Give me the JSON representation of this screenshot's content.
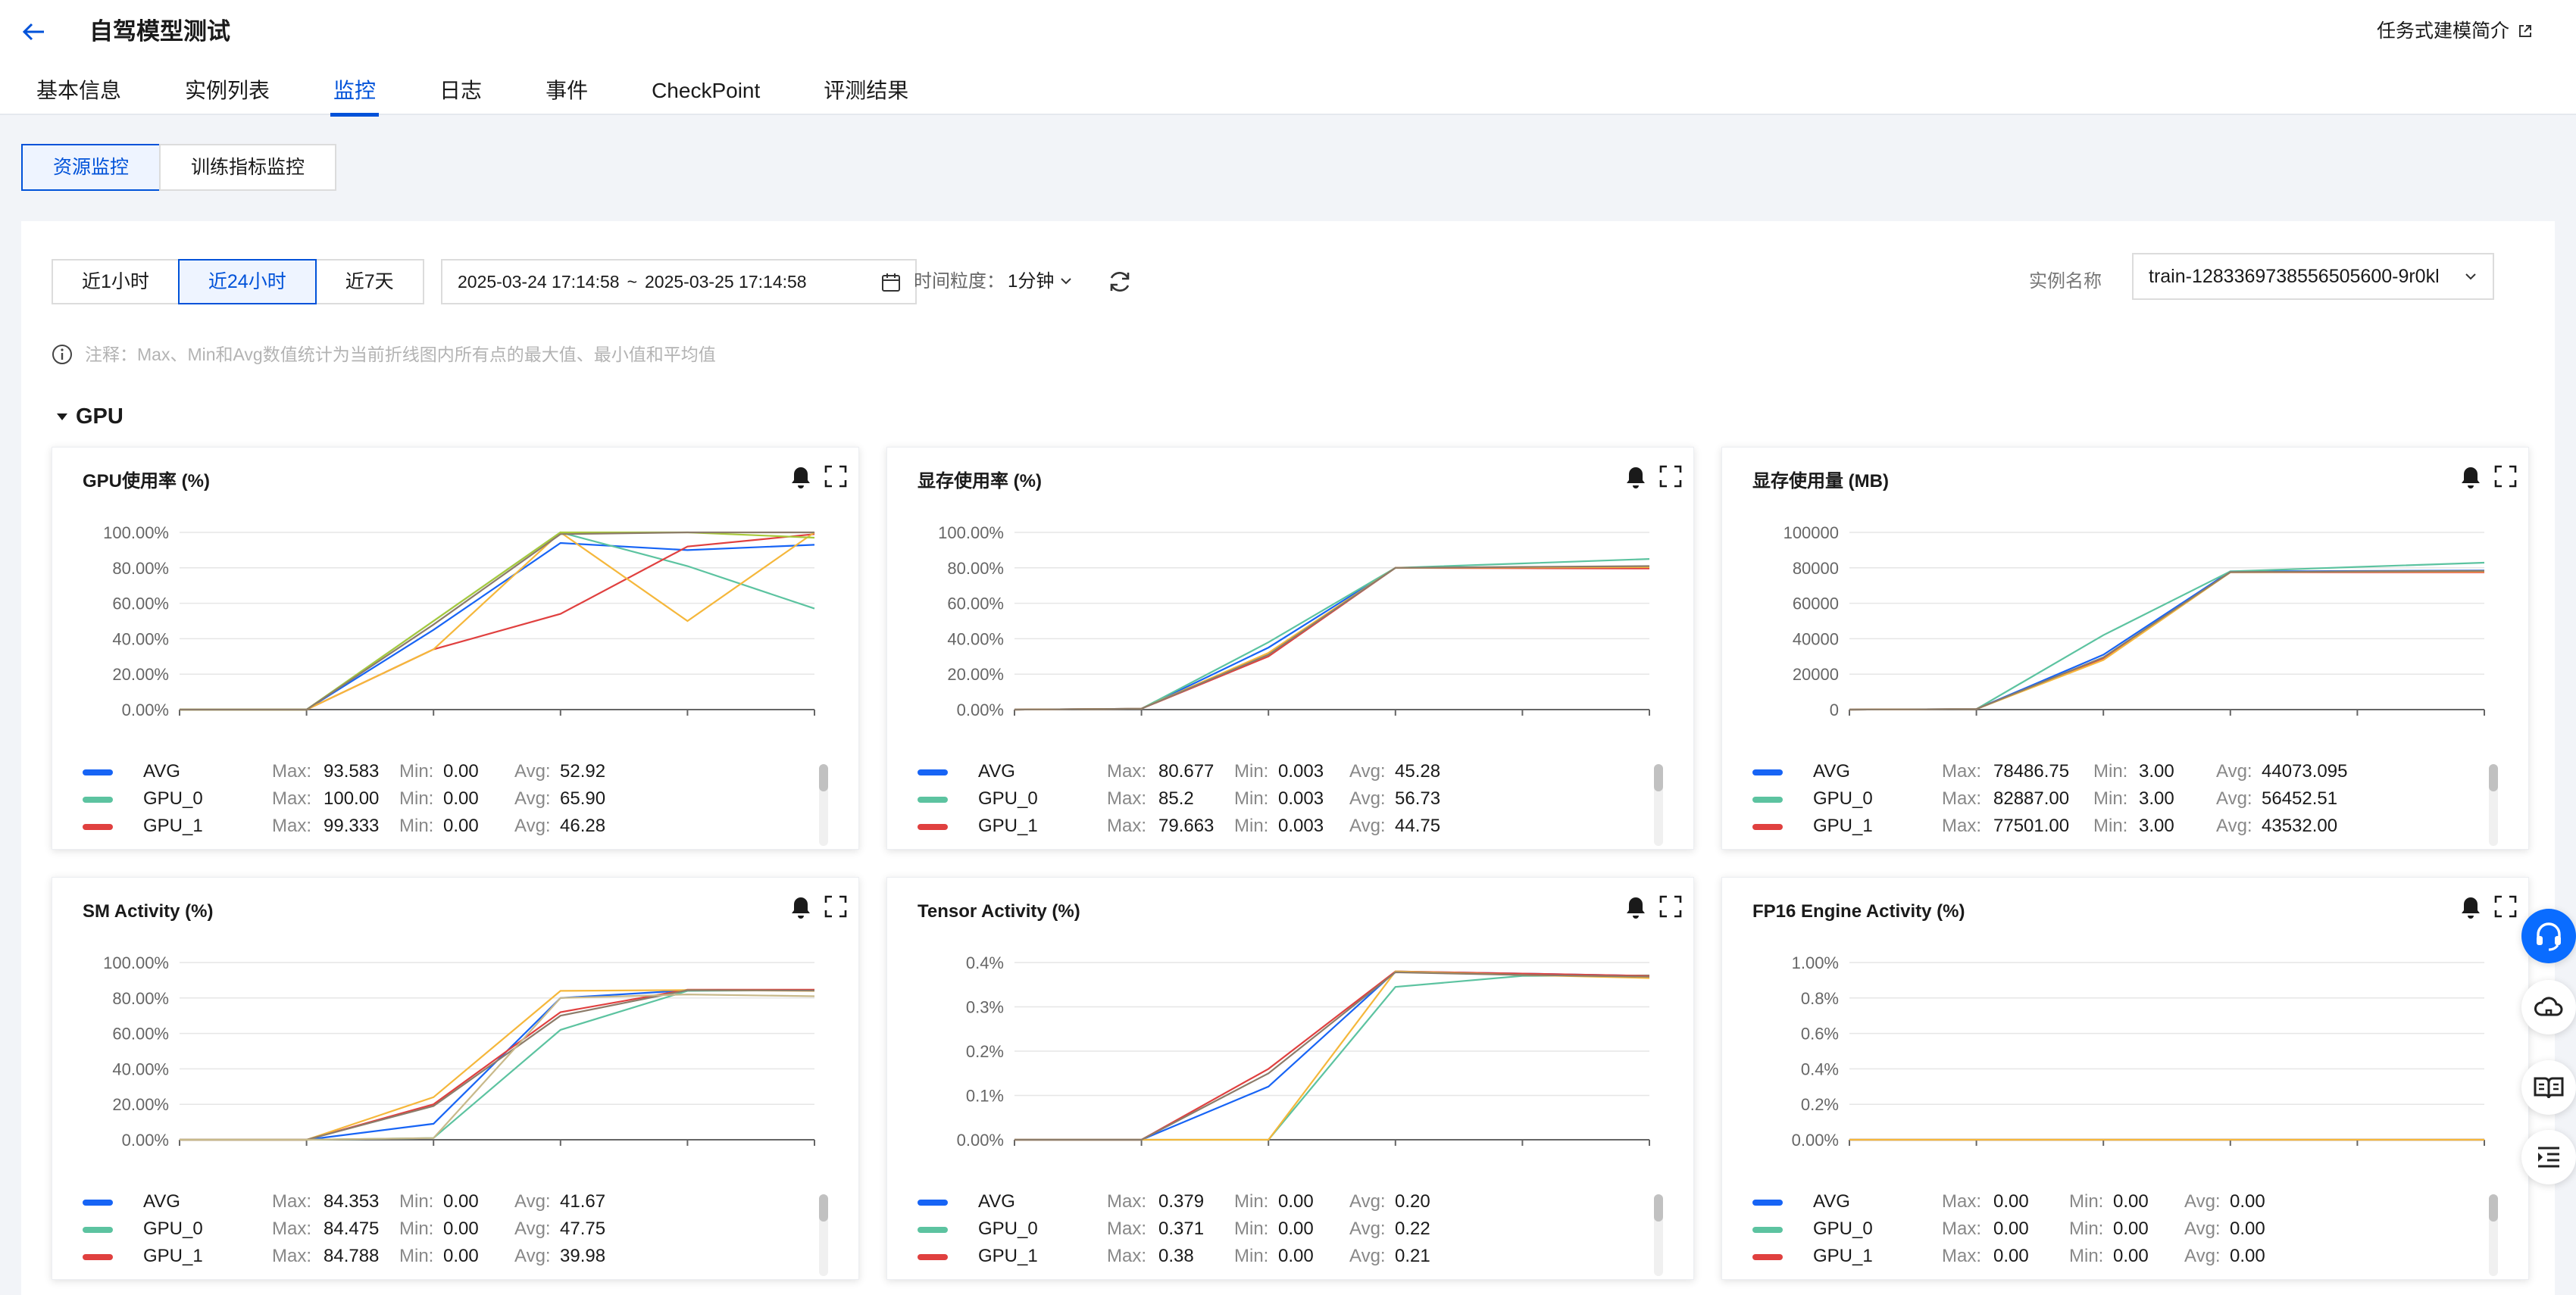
{
  "header": {
    "title": "自驾模型测试",
    "intro_link": "任务式建模简介"
  },
  "tabs": [
    {
      "label": "基本信息",
      "active": false
    },
    {
      "label": "实例列表",
      "active": false
    },
    {
      "label": "监控",
      "active": true
    },
    {
      "label": "日志",
      "active": false
    },
    {
      "label": "事件",
      "active": false
    },
    {
      "label": "CheckPoint",
      "active": false
    },
    {
      "label": "评测结果",
      "active": false
    }
  ],
  "subtabs": [
    {
      "label": "资源监控",
      "active": true
    },
    {
      "label": "训练指标监控",
      "active": false
    }
  ],
  "toolbar": {
    "ranges": [
      {
        "label": "近1小时",
        "active": false
      },
      {
        "label": "近24小时",
        "active": true
      },
      {
        "label": "近7天",
        "active": false
      }
    ],
    "start": "2025-03-24 17:14:58",
    "sep": "~",
    "end": "2025-03-25 17:14:58",
    "granularity_label": "时间粒度：",
    "granularity_value": "1分钟",
    "instance_label": "实例名称",
    "instance_value": "train-1283369738556505600-9r0kl"
  },
  "note": "注释：Max、Min和Avg数值统计为当前折线图内所有点的最大值、最小值和平均值",
  "section": "GPU",
  "colors": {
    "avg": "#1764f5",
    "gpu0": "#5cc3a0",
    "gpu1": "#e0403f",
    "extra1": "#f5b73b",
    "extra2": "#a8c93b",
    "extra3": "#8c7c6a"
  },
  "legend_labels": {
    "max": "Max:",
    "min": "Min:",
    "avg": "Avg:"
  },
  "cards": [
    {
      "title": "GPU使用率 (%)",
      "stats": [
        {
          "name": "AVG",
          "max": "93.583",
          "min": "0.00",
          "avg": "52.92"
        },
        {
          "name": "GPU_0",
          "max": "100.00",
          "min": "0.00",
          "avg": "65.90"
        },
        {
          "name": "GPU_1",
          "max": "99.333",
          "min": "0.00",
          "avg": "46.28"
        }
      ]
    },
    {
      "title": "显存使用率 (%)",
      "stats": [
        {
          "name": "AVG",
          "max": "80.677",
          "min": "0.003",
          "avg": "45.28"
        },
        {
          "name": "GPU_0",
          "max": "85.2",
          "min": "0.003",
          "avg": "56.73"
        },
        {
          "name": "GPU_1",
          "max": "79.663",
          "min": "0.003",
          "avg": "44.75"
        }
      ]
    },
    {
      "title": "显存使用量 (MB)",
      "stats": [
        {
          "name": "AVG",
          "max": "78486.75",
          "min": "3.00",
          "avg": "44073.095"
        },
        {
          "name": "GPU_0",
          "max": "82887.00",
          "min": "3.00",
          "avg": "56452.51"
        },
        {
          "name": "GPU_1",
          "max": "77501.00",
          "min": "3.00",
          "avg": "43532.00"
        }
      ]
    },
    {
      "title": "SM Activity (%)",
      "stats": [
        {
          "name": "AVG",
          "max": "84.353",
          "min": "0.00",
          "avg": "41.67"
        },
        {
          "name": "GPU_0",
          "max": "84.475",
          "min": "0.00",
          "avg": "47.75"
        },
        {
          "name": "GPU_1",
          "max": "84.788",
          "min": "0.00",
          "avg": "39.98"
        }
      ]
    },
    {
      "title": "Tensor Activity (%)",
      "stats": [
        {
          "name": "AVG",
          "max": "0.379",
          "min": "0.00",
          "avg": "0.20"
        },
        {
          "name": "GPU_0",
          "max": "0.371",
          "min": "0.00",
          "avg": "0.22"
        },
        {
          "name": "GPU_1",
          "max": "0.38",
          "min": "0.00",
          "avg": "0.21"
        }
      ]
    },
    {
      "title": "FP16 Engine Activity (%)",
      "stats": [
        {
          "name": "AVG",
          "max": "0.00",
          "min": "0.00",
          "avg": "0.00"
        },
        {
          "name": "GPU_0",
          "max": "0.00",
          "min": "0.00",
          "avg": "0.00"
        },
        {
          "name": "GPU_1",
          "max": "0.00",
          "min": "0.00",
          "avg": "0.00"
        }
      ]
    }
  ],
  "chart_data": [
    {
      "type": "line",
      "title": "GPU使用率 (%)",
      "yticks": [
        "0.00%",
        "20.00%",
        "40.00%",
        "60.00%",
        "80.00%",
        "100.00%"
      ],
      "ylim": [
        0,
        100
      ],
      "x": [
        0,
        1,
        2,
        3,
        4,
        5
      ],
      "series": [
        {
          "name": "AVG",
          "color": "#1764f5",
          "values": [
            0,
            0,
            45,
            94,
            90,
            93
          ]
        },
        {
          "name": "GPU_0",
          "color": "#5cc3a0",
          "values": [
            0,
            0,
            50,
            100,
            81,
            57
          ]
        },
        {
          "name": "GPU_1",
          "color": "#e0403f",
          "values": [
            0,
            0,
            34,
            54,
            92,
            99
          ]
        },
        {
          "color": "#f5b73b",
          "values": [
            0,
            0,
            34,
            100,
            50,
            100
          ]
        },
        {
          "color": "#a8c93b",
          "values": [
            0,
            0,
            50,
            100,
            100,
            97
          ]
        },
        {
          "color": "#8c7c6a",
          "values": [
            0,
            0,
            48,
            99,
            100,
            100
          ]
        }
      ]
    },
    {
      "type": "line",
      "title": "显存使用率 (%)",
      "yticks": [
        "0.00%",
        "20.00%",
        "40.00%",
        "60.00%",
        "80.00%",
        "100.00%"
      ],
      "ylim": [
        0,
        100
      ],
      "x": [
        0,
        1,
        2,
        3,
        4,
        5
      ],
      "series": [
        {
          "name": "AVG",
          "color": "#1764f5",
          "values": [
            0,
            0.5,
            35,
            80,
            80.3,
            80.6
          ]
        },
        {
          "name": "GPU_0",
          "color": "#5cc3a0",
          "values": [
            0,
            0.5,
            38,
            80,
            82.5,
            85
          ]
        },
        {
          "name": "GPU_1",
          "color": "#e0403f",
          "values": [
            0,
            0.5,
            30,
            80,
            79.8,
            79.6
          ]
        },
        {
          "color": "#f5b73b",
          "values": [
            0,
            0.5,
            32,
            80,
            80.2,
            80.4
          ]
        },
        {
          "color": "#8c7c6a",
          "values": [
            0,
            0.5,
            31,
            80,
            80.5,
            81
          ]
        }
      ]
    },
    {
      "type": "line",
      "title": "显存使用量 (MB)",
      "yticks": [
        "0",
        "20000",
        "40000",
        "60000",
        "80000",
        "100000"
      ],
      "ylim": [
        0,
        100000
      ],
      "x": [
        0,
        1,
        2,
        3,
        4,
        5
      ],
      "series": [
        {
          "name": "AVG",
          "color": "#1764f5",
          "values": [
            0,
            300,
            31000,
            78000,
            78200,
            78486
          ]
        },
        {
          "name": "GPU_0",
          "color": "#5cc3a0",
          "values": [
            0,
            300,
            42000,
            78000,
            80500,
            82887
          ]
        },
        {
          "name": "GPU_1",
          "color": "#e0403f",
          "values": [
            0,
            300,
            29000,
            77500,
            77500,
            77501
          ]
        },
        {
          "color": "#f5b73b",
          "values": [
            0,
            300,
            28000,
            77500,
            77800,
            78000
          ]
        },
        {
          "color": "#8c7c6a",
          "values": [
            0,
            300,
            29500,
            77600,
            78000,
            78300
          ]
        }
      ]
    },
    {
      "type": "line",
      "title": "SM Activity (%)",
      "yticks": [
        "0.00%",
        "20.00%",
        "40.00%",
        "60.00%",
        "80.00%",
        "100.00%"
      ],
      "ylim": [
        0,
        100
      ],
      "x": [
        0,
        1,
        2,
        3,
        4,
        5
      ],
      "series": [
        {
          "name": "AVG",
          "color": "#1764f5",
          "values": [
            0,
            0,
            9,
            80,
            84.3,
            84.3
          ]
        },
        {
          "name": "GPU_0",
          "color": "#5cc3a0",
          "values": [
            0,
            0,
            1,
            62,
            84,
            84.4
          ]
        },
        {
          "name": "GPU_1",
          "color": "#e0403f",
          "values": [
            0,
            0,
            20,
            72,
            84.7,
            84.7
          ]
        },
        {
          "color": "#f5b73b",
          "values": [
            0,
            0,
            24,
            84,
            84.5,
            84
          ]
        },
        {
          "color": "#8c7c6a",
          "values": [
            0,
            0,
            19,
            70,
            84.4,
            84.2
          ]
        },
        {
          "color": "#c8b98a",
          "values": [
            0,
            0,
            1,
            80,
            82,
            81
          ]
        }
      ]
    },
    {
      "type": "line",
      "title": "Tensor Activity (%)",
      "yticks": [
        "0.00%",
        "0.1%",
        "0.2%",
        "0.3%",
        "0.4%"
      ],
      "ylim": [
        0,
        0.4
      ],
      "x": [
        0,
        1,
        2,
        3,
        4,
        5
      ],
      "series": [
        {
          "name": "AVG",
          "color": "#1764f5",
          "values": [
            0,
            0,
            0.12,
            0.38,
            0.375,
            0.37
          ]
        },
        {
          "name": "GPU_0",
          "color": "#5cc3a0",
          "values": [
            0,
            0,
            0,
            0.345,
            0.37,
            0.371
          ]
        },
        {
          "name": "GPU_1",
          "color": "#e0403f",
          "values": [
            0,
            0,
            0.16,
            0.38,
            0.375,
            0.37
          ]
        },
        {
          "color": "#f5b73b",
          "values": [
            0,
            0,
            0,
            0.38,
            0.372,
            0.365
          ]
        },
        {
          "color": "#8c7c6a",
          "values": [
            0,
            0,
            0.15,
            0.378,
            0.372,
            0.368
          ]
        }
      ]
    },
    {
      "type": "line",
      "title": "FP16 Engine Activity (%)",
      "yticks": [
        "0.00%",
        "0.2%",
        "0.4%",
        "0.6%",
        "0.8%",
        "1.00%"
      ],
      "ylim": [
        0,
        1
      ],
      "x": [
        0,
        1,
        2,
        3,
        4,
        5
      ],
      "series": [
        {
          "name": "AVG",
          "color": "#1764f5",
          "values": [
            0,
            0,
            0,
            0,
            0,
            0
          ]
        },
        {
          "name": "GPU_0",
          "color": "#5cc3a0",
          "values": [
            0,
            0,
            0,
            0,
            0,
            0
          ]
        },
        {
          "name": "GPU_1",
          "color": "#e0403f",
          "values": [
            0,
            0,
            0,
            0,
            0,
            0
          ]
        },
        {
          "color": "#f5b73b",
          "values": [
            0,
            0,
            0,
            0,
            0,
            0
          ]
        }
      ]
    }
  ]
}
